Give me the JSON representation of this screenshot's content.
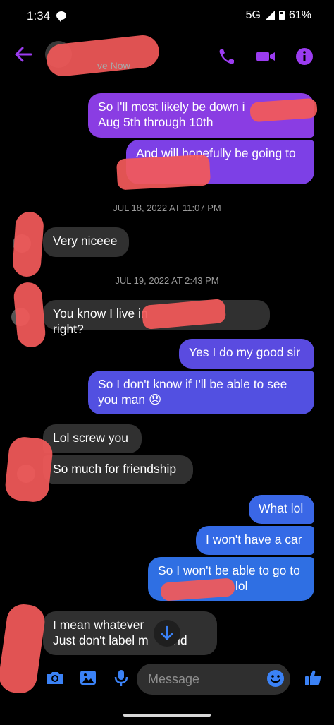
{
  "status_bar": {
    "time": "1:34",
    "network": "5G",
    "battery": "61%"
  },
  "header": {
    "status_suffix": "ve Now"
  },
  "messages": [
    {
      "line1": "So I'll most likely be down i",
      "line2": "Aug 5th through 10th"
    },
    {
      "line1": "And will hopefully be going to"
    },
    {
      "date": "JUL 18, 2022 AT 11:07 PM"
    },
    {
      "text": "Very niceee"
    },
    {
      "date": "JUL 19, 2022 AT 2:43 PM"
    },
    {
      "text_a": "You know I live in",
      "text_b": "right?"
    },
    {
      "text": "Yes I do my good sir"
    },
    {
      "line1": "So I don't know if I'll be able to see",
      "line2": "you man 😞"
    },
    {
      "text": "Lol screw you"
    },
    {
      "text": "So much for friendship"
    },
    {
      "text": "What lol"
    },
    {
      "text": "I won't have a car"
    },
    {
      "line1": "So I won't be able to go to",
      "line2": "lol"
    },
    {
      "line1": "I mean whatever",
      "line2": "Just don't label m",
      "line2b": "riend"
    }
  ],
  "composer": {
    "placeholder": "Message"
  },
  "colors": {
    "accent_purple": "#9b3cf0",
    "bubble_purple": "#8a3de3",
    "bubble_indigo": "#5a4be0",
    "bubble_blue": "#2f6fe3",
    "incoming": "#303030",
    "redaction": "#f25959"
  },
  "icons": [
    "back-arrow-icon",
    "phone-icon",
    "video-icon",
    "info-icon",
    "camera-icon",
    "image-icon",
    "mic-icon",
    "emoji-icon",
    "thumbs-up-icon",
    "arrow-down-icon",
    "chat-bubble-icon",
    "signal-icon",
    "battery-icon"
  ]
}
